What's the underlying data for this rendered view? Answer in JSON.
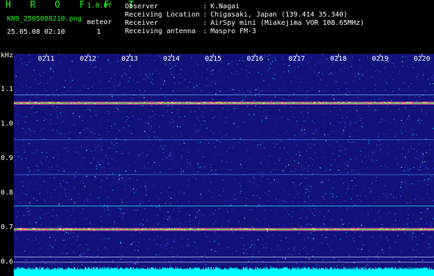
{
  "header": {
    "logo": "H R O F F T",
    "version": "1.0.0f",
    "filename": "KN9_2505080210.png",
    "meteor_label": "meteor",
    "meteor_count": "1",
    "timestamp": "25.05.08 02:10",
    "rows": [
      {
        "label": "Observer",
        "sep": ":",
        "value": "K.Nagai"
      },
      {
        "label": "Receiving Location",
        "sep": ":",
        "value": "Chigasaki, Japan (139.414 35.340)"
      },
      {
        "label": "Receiver",
        "sep": ":",
        "value": "AirSpy mini (Miakejima VOR 108.65MHz)"
      },
      {
        "label": "Receiving antenna",
        "sep": ":",
        "value": "Maspro FM-3"
      }
    ]
  },
  "axis": {
    "unit": "kHz",
    "y_ticks": [
      {
        "label": "1.1",
        "v": 1.1
      },
      {
        "label": "1.0",
        "v": 1.0
      },
      {
        "label": "0.9",
        "v": 0.9
      },
      {
        "label": "0.8",
        "v": 0.8
      },
      {
        "label": "0.7",
        "v": 0.7
      },
      {
        "label": "0.6",
        "v": 0.6
      }
    ],
    "x_ticks": [
      "0211",
      "0212",
      "0213",
      "0214",
      "0215",
      "0216",
      "0217",
      "0218",
      "0219",
      "0220"
    ]
  },
  "colors": {
    "background": "#12127a",
    "band": "#55ff55",
    "band_edge": "#ff4488",
    "noise": "#00ffff"
  }
}
